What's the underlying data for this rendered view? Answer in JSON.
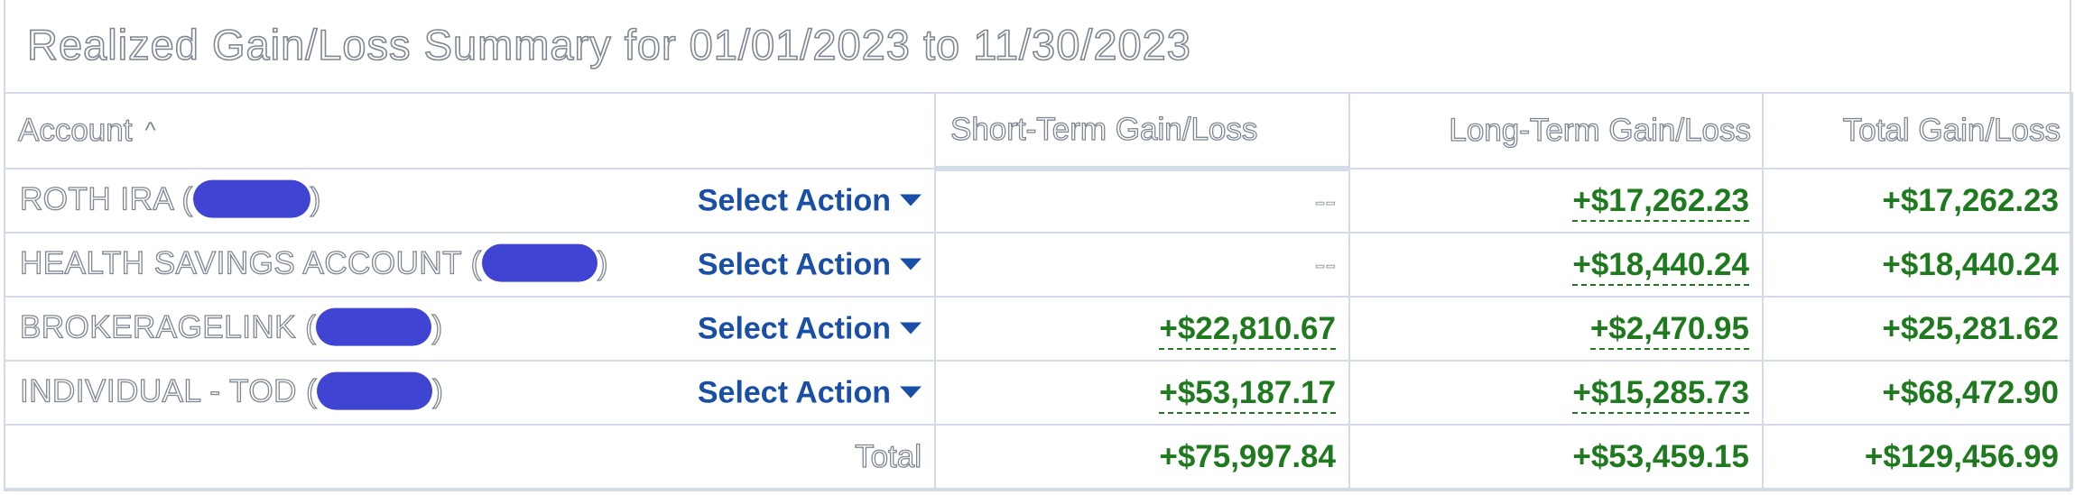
{
  "title": "Realized Gain/Loss Summary for 01/01/2023 to 11/30/2023",
  "columns": {
    "account": "Account",
    "short_term": "Short-Term Gain/Loss",
    "long_term": "Long-Term Gain/Loss",
    "total": "Total Gain/Loss"
  },
  "sort_icon": "chevron-up-icon",
  "action_label": "Select Action",
  "rows": [
    {
      "name": "ROTH IRA",
      "short_term": "--",
      "long_term": "+$17,262.23",
      "total": "+$17,262.23"
    },
    {
      "name": "HEALTH SAVINGS ACCOUNT",
      "short_term": "--",
      "long_term": "+$18,440.24",
      "total": "+$18,440.24"
    },
    {
      "name": "BROKERAGELINK",
      "short_term": "+$22,810.67",
      "long_term": "+$2,470.95",
      "total": "+$25,281.62"
    },
    {
      "name": "INDIVIDUAL - TOD",
      "short_term": "+$53,187.17",
      "long_term": "+$15,285.73",
      "total": "+$68,472.90"
    }
  ],
  "totals": {
    "label": "Total",
    "short_term": "+$75,997.84",
    "long_term": "+$53,459.15",
    "total": "+$129,456.99"
  },
  "colors": {
    "gain": "#1f7a1f",
    "link": "#1a4fa8",
    "redaction": "#3f44d2",
    "border": "#d3dbe6"
  }
}
